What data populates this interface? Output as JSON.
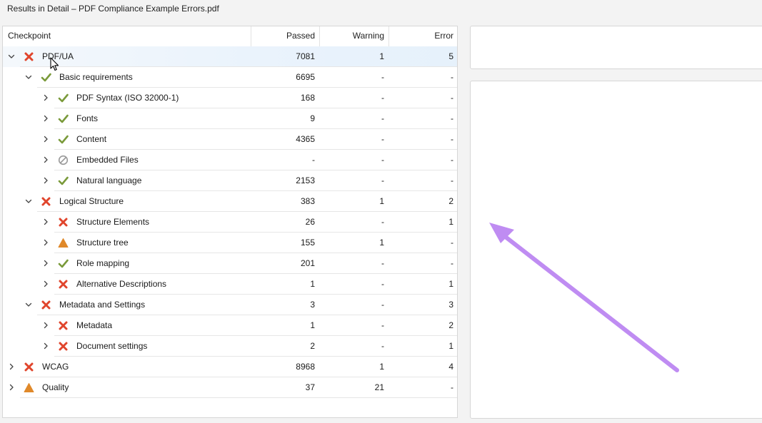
{
  "window": {
    "title": "Results in Detail – PDF Compliance Example Errors.pdf"
  },
  "table": {
    "columns": {
      "checkpoint": "Checkpoint",
      "passed": "Passed",
      "warning": "Warning",
      "error": "Error"
    },
    "rows": [
      {
        "label": "PDF/UA",
        "status": "error",
        "expanded": true,
        "level": 0,
        "passed": "7081",
        "warning": "1",
        "error": "5",
        "selected": true
      },
      {
        "label": "Basic requirements",
        "status": "pass",
        "expanded": true,
        "level": 1,
        "passed": "6695",
        "warning": "-",
        "error": "-"
      },
      {
        "label": "PDF Syntax (ISO 32000-1)",
        "status": "pass",
        "expanded": false,
        "level": 2,
        "passed": "168",
        "warning": "-",
        "error": "-"
      },
      {
        "label": "Fonts",
        "status": "pass",
        "expanded": false,
        "level": 2,
        "passed": "9",
        "warning": "-",
        "error": "-"
      },
      {
        "label": "Content",
        "status": "pass",
        "expanded": false,
        "level": 2,
        "passed": "4365",
        "warning": "-",
        "error": "-"
      },
      {
        "label": "Embedded Files",
        "status": "na",
        "expanded": false,
        "level": 2,
        "passed": "-",
        "warning": "-",
        "error": "-"
      },
      {
        "label": "Natural language",
        "status": "pass",
        "expanded": false,
        "level": 2,
        "passed": "2153",
        "warning": "-",
        "error": "-"
      },
      {
        "label": "Logical Structure",
        "status": "error",
        "expanded": true,
        "level": 1,
        "passed": "383",
        "warning": "1",
        "error": "2"
      },
      {
        "label": "Structure Elements",
        "status": "error",
        "expanded": false,
        "level": 2,
        "passed": "26",
        "warning": "-",
        "error": "1"
      },
      {
        "label": "Structure tree",
        "status": "warning",
        "expanded": false,
        "level": 2,
        "passed": "155",
        "warning": "1",
        "error": "-"
      },
      {
        "label": "Role mapping",
        "status": "pass",
        "expanded": false,
        "level": 2,
        "passed": "201",
        "warning": "-",
        "error": "-"
      },
      {
        "label": "Alternative Descriptions",
        "status": "error",
        "expanded": false,
        "level": 2,
        "passed": "1",
        "warning": "-",
        "error": "1"
      },
      {
        "label": "Metadata and Settings",
        "status": "error",
        "expanded": true,
        "level": 1,
        "passed": "3",
        "warning": "-",
        "error": "3"
      },
      {
        "label": "Metadata",
        "status": "error",
        "expanded": false,
        "level": 2,
        "passed": "1",
        "warning": "-",
        "error": "2"
      },
      {
        "label": "Document settings",
        "status": "error",
        "expanded": false,
        "level": 2,
        "passed": "2",
        "warning": "-",
        "error": "1"
      },
      {
        "label": "WCAG",
        "status": "error",
        "expanded": false,
        "level": 0,
        "passed": "8968",
        "warning": "1",
        "error": "4"
      },
      {
        "label": "Quality",
        "status": "warning",
        "expanded": false,
        "level": 0,
        "passed": "37",
        "warning": "21",
        "error": "-"
      }
    ]
  },
  "icons": {
    "pass": "checkmark-icon",
    "error": "cross-icon",
    "warning": "warning-triangle-icon",
    "na": "not-applicable-icon",
    "expanded": "chevron-down-icon",
    "collapsed": "chevron-right-icon"
  },
  "colors": {
    "pass": "#7a9a3a",
    "error": "#e0452c",
    "warning": "#e0892a",
    "na": "#9a9a9a",
    "annotation": "#bf8cf2",
    "selection": "#e6f1fb"
  }
}
